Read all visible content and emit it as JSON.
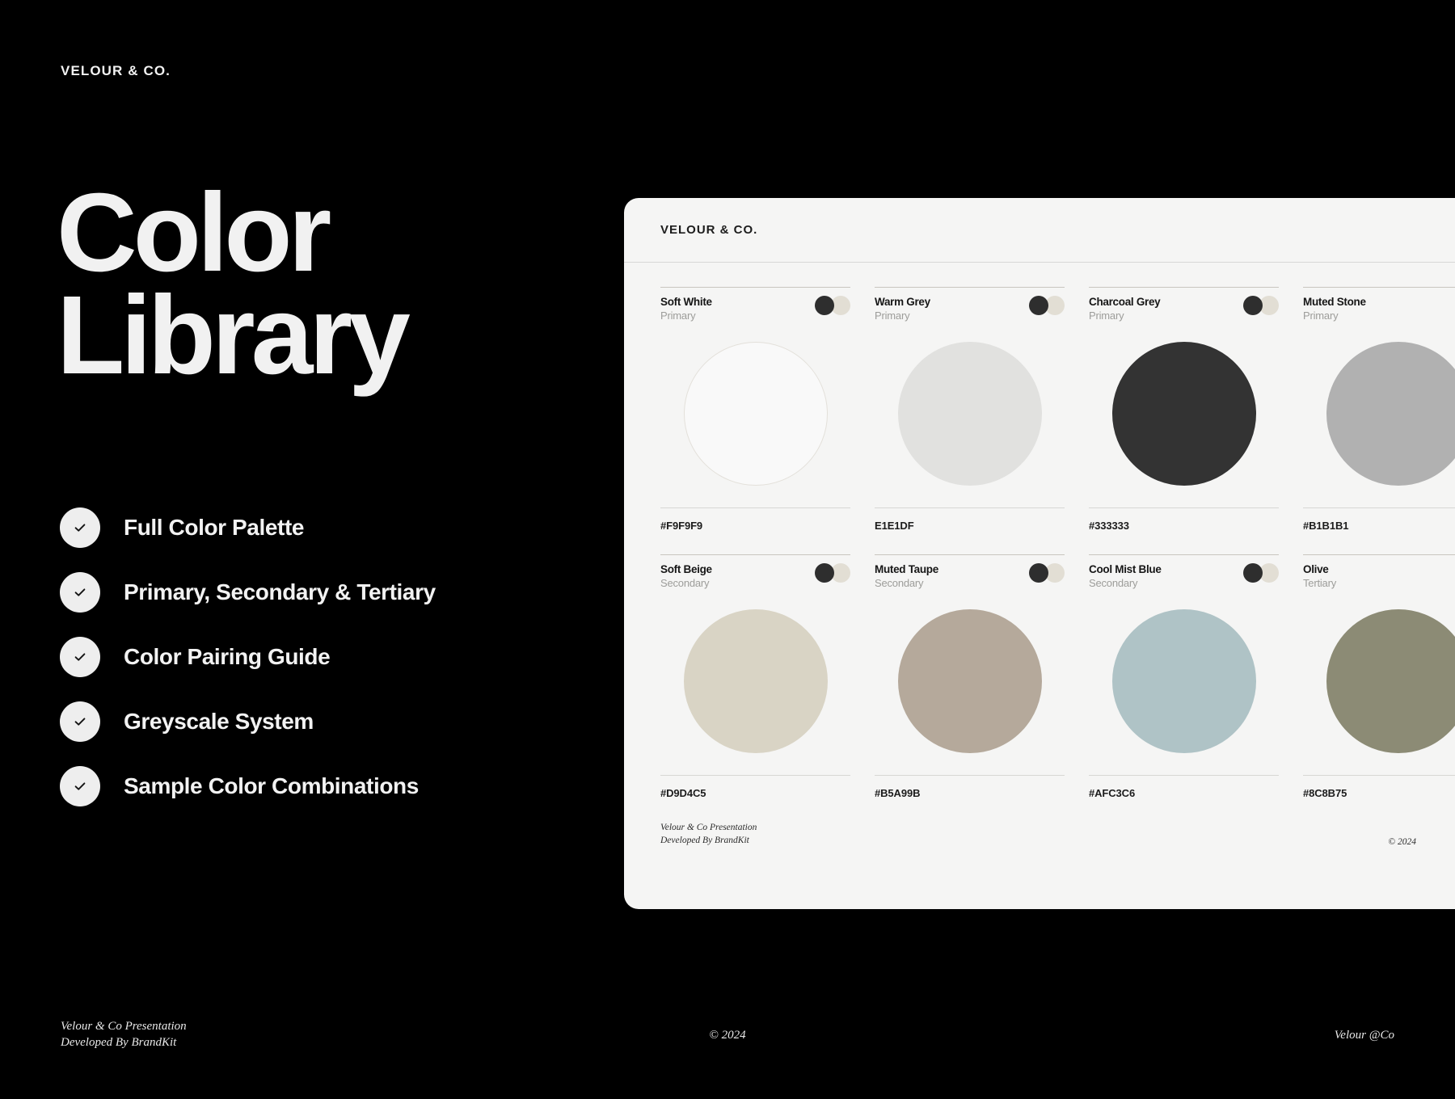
{
  "brand": "VELOUR & CO.",
  "headline": {
    "line1": "Color",
    "line2": "Library"
  },
  "checklist": [
    {
      "label": "Full Color Palette",
      "icon": "check-icon"
    },
    {
      "label": "Primary, Secondary & Tertiary",
      "icon": "check-icon"
    },
    {
      "label": "Color Pairing Guide",
      "icon": "check-icon"
    },
    {
      "label": "Greyscale System",
      "icon": "check-icon"
    },
    {
      "label": "Sample Color Combinations",
      "icon": "check-icon"
    }
  ],
  "slide_footer": {
    "left_line1": "Velour & Co Presentation",
    "left_line2": "Developed By BrandKit",
    "center": "© 2024",
    "right": "Velour @Co"
  },
  "panel": {
    "brand": "VELOUR & CO.",
    "footer_line1": "Velour & Co Presentation",
    "footer_line2": "Developed By BrandKit",
    "footer_right": "© 2024",
    "dot_front_color": "#2E2E2E",
    "dot_back_color": "#E2DED4",
    "swatches": [
      {
        "name": "Soft White",
        "role": "Primary",
        "hex_label": "#F9F9F9",
        "color": "#F9F9F9",
        "border": "#E3E0DA"
      },
      {
        "name": "Warm Grey",
        "role": "Primary",
        "hex_label": "E1E1DF",
        "color": "#E1E1DF",
        "border": "#E1E1DF"
      },
      {
        "name": "Charcoal Grey",
        "role": "Primary",
        "hex_label": "#333333",
        "color": "#333333",
        "border": "#333333"
      },
      {
        "name": "Muted Stone",
        "role": "Primary",
        "hex_label": "#B1B1B1",
        "color": "#B1B1B1",
        "border": "#B1B1B1"
      },
      {
        "name": "Soft Beige",
        "role": "Secondary",
        "hex_label": "#D9D4C5",
        "color": "#D9D4C5",
        "border": "#D9D4C5"
      },
      {
        "name": "Muted Taupe",
        "role": "Secondary",
        "hex_label": "#B5A99B",
        "color": "#B5A99B",
        "border": "#B5A99B"
      },
      {
        "name": "Cool Mist Blue",
        "role": "Secondary",
        "hex_label": "#AFC3C6",
        "color": "#AFC3C6",
        "border": "#AFC3C6"
      },
      {
        "name": "Olive",
        "role": "Tertiary",
        "hex_label": "#8C8B75",
        "color": "#8C8B75",
        "border": "#8C8B75"
      }
    ]
  }
}
